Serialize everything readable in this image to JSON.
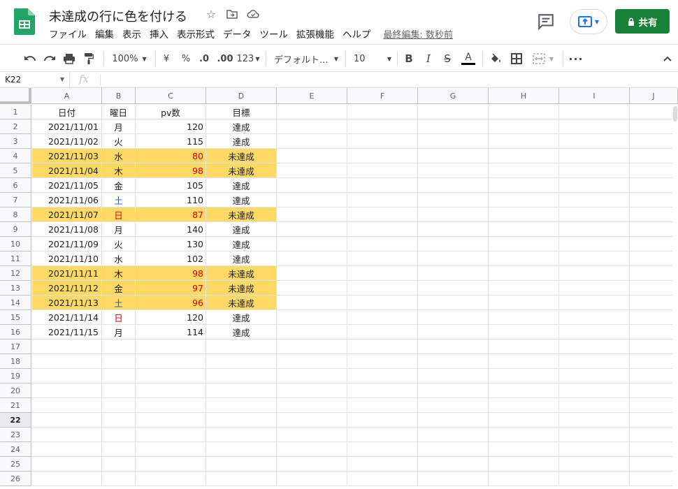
{
  "app": {
    "doc_title": "未達成の行に色を付ける",
    "menu": [
      "ファイル",
      "編集",
      "表示",
      "挿入",
      "表示形式",
      "データ",
      "ツール",
      "拡張機能",
      "ヘルプ"
    ],
    "last_edit": "最終編集: 数秒前",
    "share_label": "共有"
  },
  "colors": {
    "accent_green": "#188038",
    "highlight": "#ffd966",
    "red_text": "#e00000",
    "blue_text": "#1155cc",
    "present_blue": "#1a73e8"
  },
  "toolbar": {
    "zoom": "100%",
    "currency": "¥",
    "percent": "%",
    "decimal_decrease": ".0",
    "decimal_increase": ".00",
    "more_formats": "123",
    "font": "デフォルト...",
    "font_size": "10",
    "bold": "B",
    "italic": "I",
    "strike": "S",
    "text_color": "A",
    "icons": [
      "undo-icon",
      "redo-icon",
      "print-icon",
      "paint-format-icon",
      "fill-color-icon",
      "borders-icon",
      "merge-cells-icon",
      "more-icon",
      "collapse-icon"
    ]
  },
  "formula_bar": {
    "name_box": "K22",
    "fx": "fx",
    "value": ""
  },
  "sheet": {
    "columns": [
      "A",
      "B",
      "C",
      "D",
      "E",
      "F",
      "G",
      "H",
      "I",
      "J"
    ],
    "row_count": 26,
    "active_row": 22,
    "rows": [
      {
        "date": "日付",
        "day": "曜日",
        "pv": "pv数",
        "goal": "目標",
        "header": true
      },
      {
        "date": "2021/11/01",
        "day": "月",
        "pv": "120",
        "goal": "達成"
      },
      {
        "date": "2021/11/02",
        "day": "火",
        "pv": "115",
        "goal": "達成"
      },
      {
        "date": "2021/11/03",
        "day": "水",
        "pv": "80",
        "goal": "未達成",
        "hl": true
      },
      {
        "date": "2021/11/04",
        "day": "木",
        "pv": "98",
        "goal": "未達成",
        "hl": true
      },
      {
        "date": "2021/11/05",
        "day": "金",
        "pv": "105",
        "goal": "達成"
      },
      {
        "date": "2021/11/06",
        "day": "土",
        "pv": "110",
        "goal": "達成",
        "day_color": "blue"
      },
      {
        "date": "2021/11/07",
        "day": "日",
        "pv": "87",
        "goal": "未達成",
        "hl": true,
        "day_color": "red"
      },
      {
        "date": "2021/11/08",
        "day": "月",
        "pv": "140",
        "goal": "達成"
      },
      {
        "date": "2021/11/09",
        "day": "火",
        "pv": "130",
        "goal": "達成"
      },
      {
        "date": "2021/11/10",
        "day": "水",
        "pv": "102",
        "goal": "達成"
      },
      {
        "date": "2021/11/11",
        "day": "木",
        "pv": "98",
        "goal": "未達成",
        "hl": true
      },
      {
        "date": "2021/11/12",
        "day": "金",
        "pv": "97",
        "goal": "未達成",
        "hl": true
      },
      {
        "date": "2021/11/13",
        "day": "土",
        "pv": "96",
        "goal": "未達成",
        "hl": true,
        "day_color": "blue"
      },
      {
        "date": "2021/11/14",
        "day": "日",
        "pv": "120",
        "goal": "達成",
        "day_color": "red"
      },
      {
        "date": "2021/11/15",
        "day": "月",
        "pv": "114",
        "goal": "達成"
      }
    ]
  }
}
